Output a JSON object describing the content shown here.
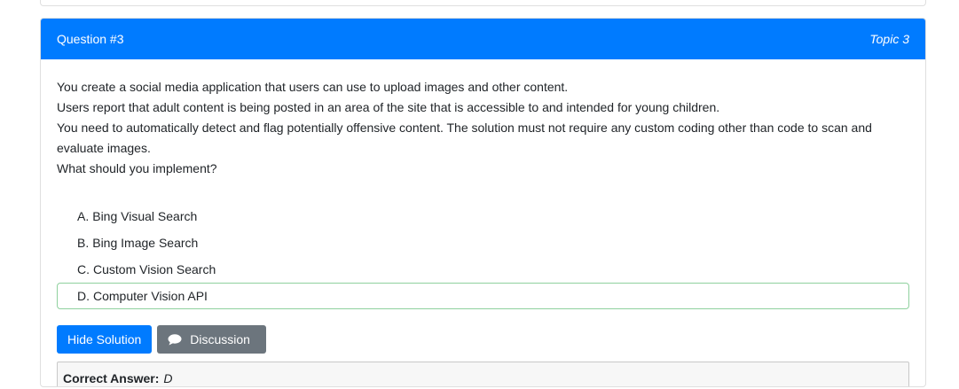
{
  "header": {
    "question_number": "Question #3",
    "topic": "Topic 3"
  },
  "question": {
    "lines": [
      "You create a social media application that users can use to upload images and other content.",
      "Users report that adult content is being posted in an area of the site that is accessible to and intended for young children.",
      "You need to automatically detect and flag potentially offensive content. The solution must not require any custom coding other than code to scan and evaluate images.",
      "What should you implement?"
    ]
  },
  "choices": [
    {
      "letter": "A.",
      "text": "Bing Visual Search"
    },
    {
      "letter": "B.",
      "text": "Bing Image Search"
    },
    {
      "letter": "C.",
      "text": "Custom Vision Search"
    },
    {
      "letter": "D.",
      "text": "Computer Vision API"
    }
  ],
  "buttons": {
    "hide_solution": "Hide Solution",
    "discussion": "Discussion"
  },
  "answer": {
    "label": "Correct Answer:",
    "value": "D"
  },
  "colors": {
    "primary": "#007bff",
    "secondary": "#6c757d",
    "correct_border": "#8fd19e"
  },
  "icons": {
    "discussion": "speech-bubble-icon"
  }
}
